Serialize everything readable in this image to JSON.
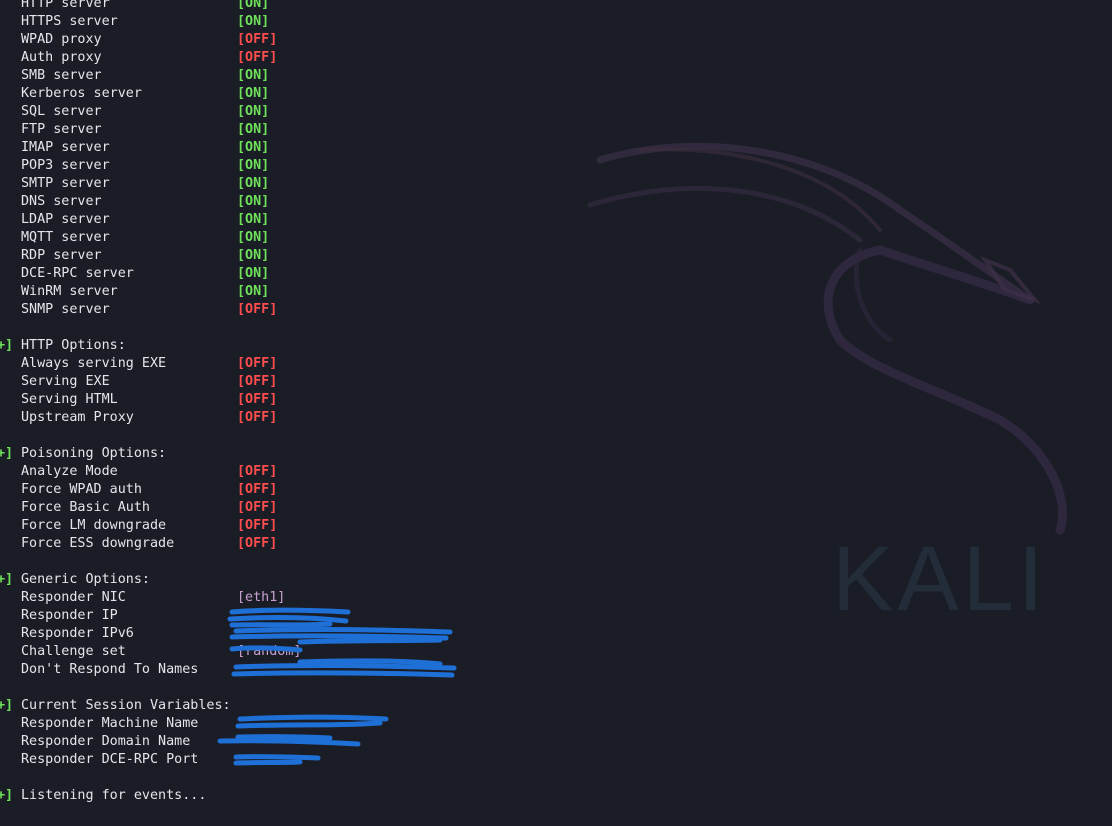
{
  "colors": {
    "background": "#1a1d25",
    "text": "#e4e6eb",
    "on": "#6ee05a",
    "off": "#ff4e4e",
    "value_purple": "#c8a0d0",
    "redaction_blue": "#1e6fd6"
  },
  "wallpaper": {
    "logo_text": "KALI",
    "icon": "kali-dragon-icon"
  },
  "servers": [
    {
      "label": "HTTP server",
      "status": "[ON]",
      "state": "on"
    },
    {
      "label": "HTTPS server",
      "status": "[ON]",
      "state": "on"
    },
    {
      "label": "WPAD proxy",
      "status": "[OFF]",
      "state": "off"
    },
    {
      "label": "Auth proxy",
      "status": "[OFF]",
      "state": "off"
    },
    {
      "label": "SMB server",
      "status": "[ON]",
      "state": "on"
    },
    {
      "label": "Kerberos server",
      "status": "[ON]",
      "state": "on"
    },
    {
      "label": "SQL server",
      "status": "[ON]",
      "state": "on"
    },
    {
      "label": "FTP server",
      "status": "[ON]",
      "state": "on"
    },
    {
      "label": "IMAP server",
      "status": "[ON]",
      "state": "on"
    },
    {
      "label": "POP3 server",
      "status": "[ON]",
      "state": "on"
    },
    {
      "label": "SMTP server",
      "status": "[ON]",
      "state": "on"
    },
    {
      "label": "DNS server",
      "status": "[ON]",
      "state": "on"
    },
    {
      "label": "LDAP server",
      "status": "[ON]",
      "state": "on"
    },
    {
      "label": "MQTT server",
      "status": "[ON]",
      "state": "on"
    },
    {
      "label": "RDP server",
      "status": "[ON]",
      "state": "on"
    },
    {
      "label": "DCE-RPC server",
      "status": "[ON]",
      "state": "on"
    },
    {
      "label": "WinRM server",
      "status": "[ON]",
      "state": "on"
    },
    {
      "label": "SNMP server",
      "status": "[OFF]",
      "state": "off"
    }
  ],
  "http_options": {
    "marker": "+]",
    "title": "HTTP Options:",
    "items": [
      {
        "label": "Always serving EXE",
        "status": "[OFF]"
      },
      {
        "label": "Serving EXE",
        "status": "[OFF]"
      },
      {
        "label": "Serving HTML",
        "status": "[OFF]"
      },
      {
        "label": "Upstream Proxy",
        "status": "[OFF]"
      }
    ]
  },
  "poisoning_options": {
    "marker": "+]",
    "title": "Poisoning Options:",
    "items": [
      {
        "label": "Analyze Mode",
        "status": "[OFF]"
      },
      {
        "label": "Force WPAD auth",
        "status": "[OFF]"
      },
      {
        "label": "Force Basic Auth",
        "status": "[OFF]"
      },
      {
        "label": "Force LM downgrade",
        "status": "[OFF]"
      },
      {
        "label": "Force ESS downgrade",
        "status": "[OFF]"
      }
    ]
  },
  "generic_options": {
    "marker": "+]",
    "title": "Generic Options:",
    "items": [
      {
        "label": "Responder NIC",
        "value": "[eth1]"
      },
      {
        "label": "Responder IP",
        "value": ""
      },
      {
        "label": "Responder IPv6",
        "value": ""
      },
      {
        "label": "Challenge set",
        "value": "[random]"
      },
      {
        "label": "Don't Respond To Names",
        "value": ""
      }
    ]
  },
  "session_variables": {
    "marker": "+]",
    "title": "Current Session Variables:",
    "items": [
      {
        "label": "Responder Machine Name",
        "value": ""
      },
      {
        "label": "Responder Domain Name",
        "value": ""
      },
      {
        "label": "Responder DCE-RPC Port",
        "value": ""
      }
    ]
  },
  "footer": {
    "marker": "+]",
    "text": "Listening for events..."
  }
}
